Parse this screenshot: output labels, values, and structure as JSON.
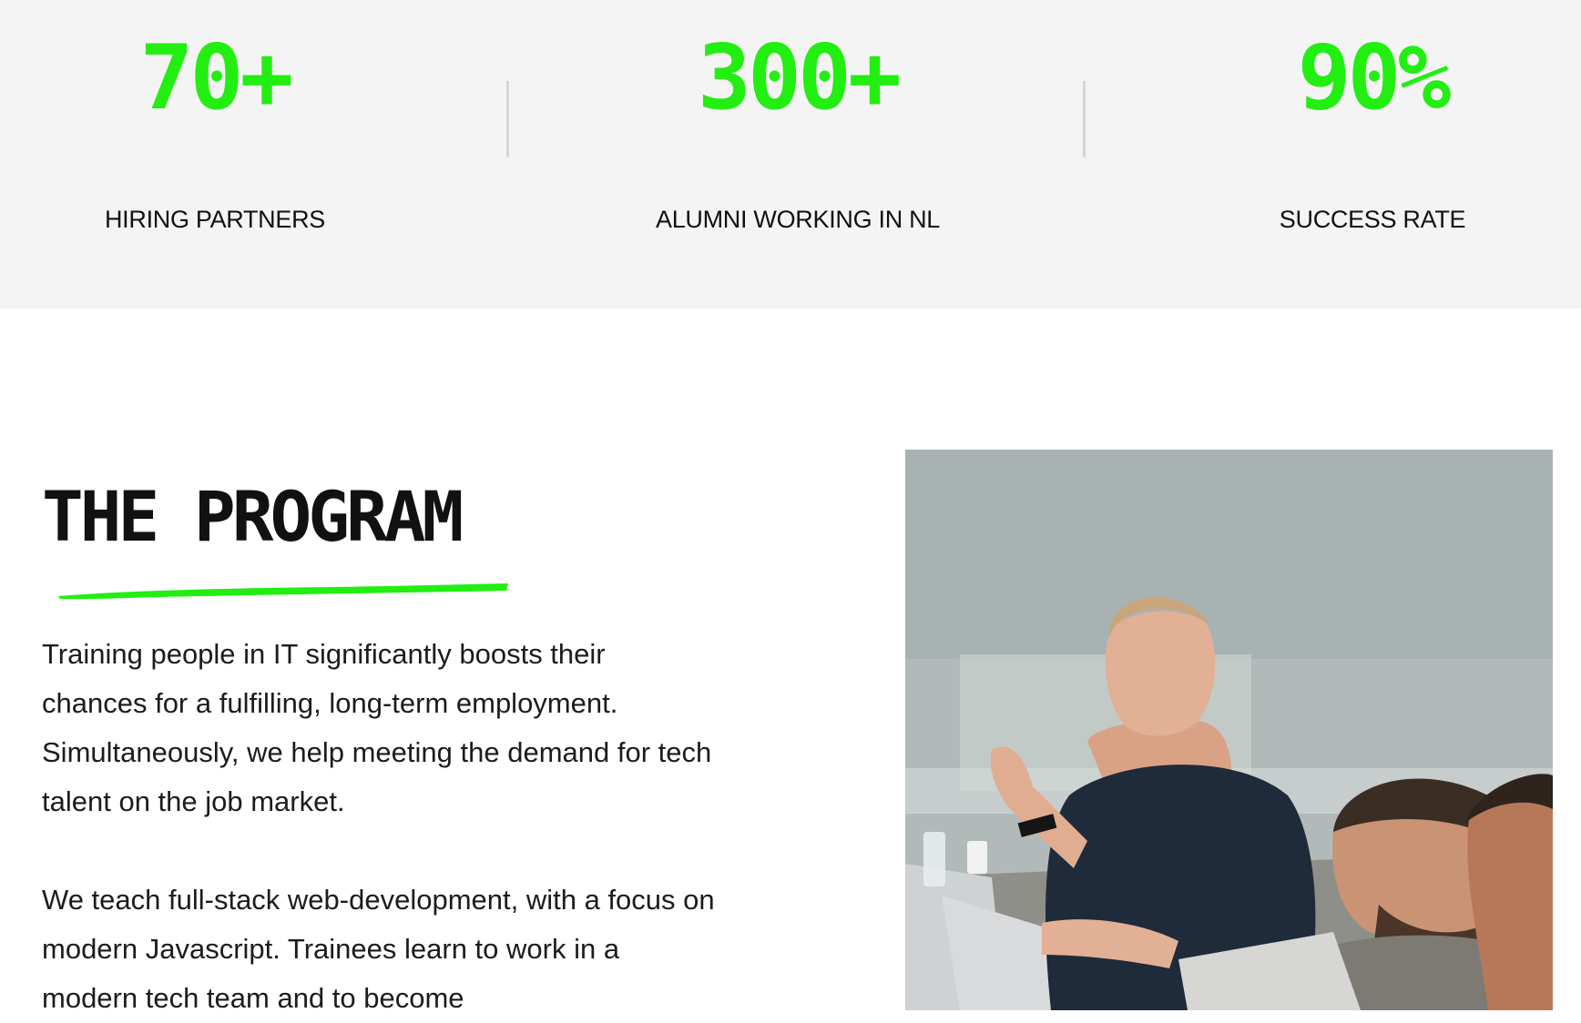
{
  "stats": [
    {
      "value": "70+",
      "label": "HIRING PARTNERS"
    },
    {
      "value": "300+",
      "label": "ALUMNI WORKING IN NL"
    },
    {
      "value": "90%",
      "label": "SUCCESS RATE"
    }
  ],
  "program": {
    "title": "THE PROGRAM",
    "paragraphs": [
      "Training people in IT significantly boosts their chances for a fulfilling, long-term employment. Simultaneously, we help meeting the demand for tech talent on the job market.",
      "We teach full-stack web-development, with a focus on modern Javascript. Trainees learn to work in a modern tech team and to become"
    ]
  },
  "colors": {
    "accent": "#22ee12",
    "stats_background": "#f4f4f4"
  },
  "image": {
    "subject": "two-men-working-at-laptops-photo"
  }
}
